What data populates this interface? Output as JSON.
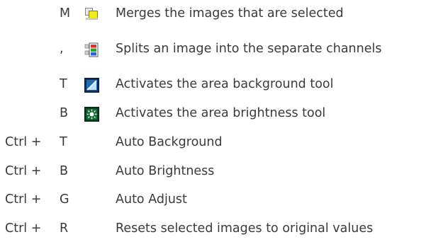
{
  "shortcuts": [
    {
      "modifier": "",
      "key": "M",
      "icon": "merge-icon",
      "description": "Merges the images that are selected"
    },
    {
      "modifier": "",
      "key": ",",
      "icon": "split-channels-icon",
      "description": "Splits an image into the separate channels"
    },
    {
      "modifier": "",
      "key": "T",
      "icon": "area-background-icon",
      "description": "Activates the area background tool"
    },
    {
      "modifier": "",
      "key": "B",
      "icon": "area-brightness-icon",
      "description": "Activates the area brightness tool"
    },
    {
      "modifier": "Ctrl +",
      "key": "T",
      "icon": "",
      "description": "Auto Background"
    },
    {
      "modifier": "Ctrl +",
      "key": "B",
      "icon": "",
      "description": "Auto Brightness"
    },
    {
      "modifier": "Ctrl +",
      "key": "G",
      "icon": "",
      "description": "Auto Adjust"
    },
    {
      "modifier": "Ctrl +",
      "key": "R",
      "icon": "",
      "description": "Resets selected images to original values"
    }
  ]
}
